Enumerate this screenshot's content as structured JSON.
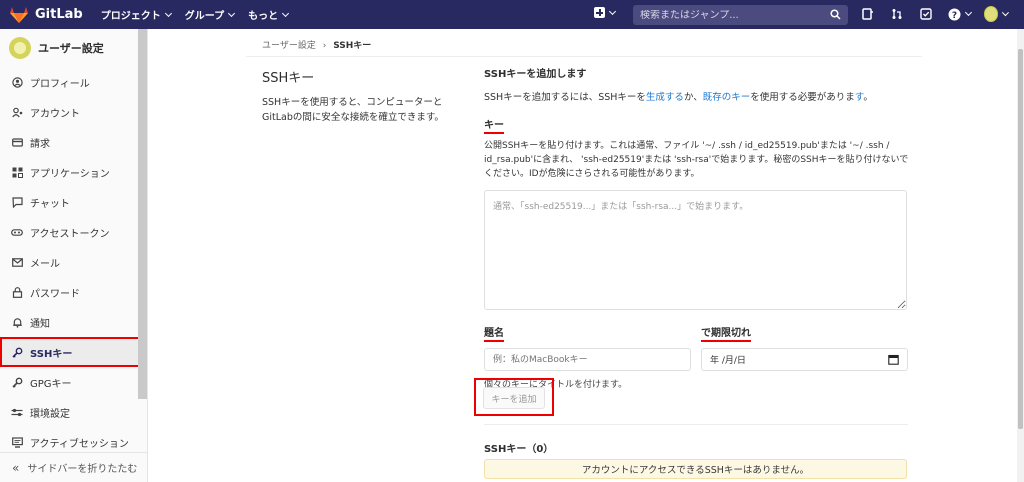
{
  "topbar": {
    "brand": "GitLab",
    "nav": [
      "プロジェクト",
      "グループ",
      "もっと"
    ],
    "search_placeholder": "検索またはジャンプ...",
    "bg": "#292961"
  },
  "sidebar": {
    "title": "ユーザー設定",
    "items": [
      {
        "label": "プロフィール",
        "icon": "profile-icon"
      },
      {
        "label": "アカウント",
        "icon": "account-icon"
      },
      {
        "label": "請求",
        "icon": "billing-icon"
      },
      {
        "label": "アプリケーション",
        "icon": "applications-icon"
      },
      {
        "label": "チャット",
        "icon": "chat-icon"
      },
      {
        "label": "アクセストークン",
        "icon": "token-icon"
      },
      {
        "label": "メール",
        "icon": "mail-icon"
      },
      {
        "label": "パスワード",
        "icon": "lock-icon"
      },
      {
        "label": "通知",
        "icon": "bell-icon"
      },
      {
        "label": "SSHキー",
        "icon": "key-icon",
        "active": true
      },
      {
        "label": "GPGキー",
        "icon": "key-icon"
      },
      {
        "label": "環境設定",
        "icon": "preferences-icon"
      },
      {
        "label": "アクティブセッション",
        "icon": "monitor-icon"
      }
    ],
    "collapse": "サイドバーを折りたたむ"
  },
  "breadcrumb": {
    "parent": "ユーザー設定",
    "sep": "›",
    "current": "SSHキー"
  },
  "intro": {
    "title": "SSHキー",
    "text": "SSHキーを使用すると、コンピューターとGitLabの間に安全な接続を確立できます。"
  },
  "form": {
    "heading": "SSHキーを追加します",
    "desc_pre": "SSHキーを追加するには、SSHキーを",
    "desc_link1": "生成する",
    "desc_mid": "か、",
    "desc_link2": "既存のキー",
    "desc_post": "を使用する必要がありま",
    "desc_link3": "す",
    "desc_end": "。",
    "key_label": "キー",
    "key_help": "公開SSHキーを貼り付けます。これは通常、ファイル '~/ .ssh / id_ed25519.pub'または '~/ .ssh / id_rsa.pub'に含まれ、 'ssh-ed25519'または 'ssh-rsa'で始まります。秘密のSSHキーを貼り付けないでください。IDが危険にさらされる可能性があります。",
    "key_placeholder": "通常、「ssh-ed25519...」または「ssh-rsa...」で始まります。",
    "title_label": "題名",
    "title_placeholder": "例：私のMacBookキー",
    "expires_label": "で期限切れ",
    "expires_placeholder": "年 /月/日",
    "title_hint": "個々のキーにタイトルを付けます。",
    "submit": "キーを追加"
  },
  "keys": {
    "heading": "SSHキー（0）",
    "empty": "アカウントにアクセスできるSSHキーはありません。"
  }
}
